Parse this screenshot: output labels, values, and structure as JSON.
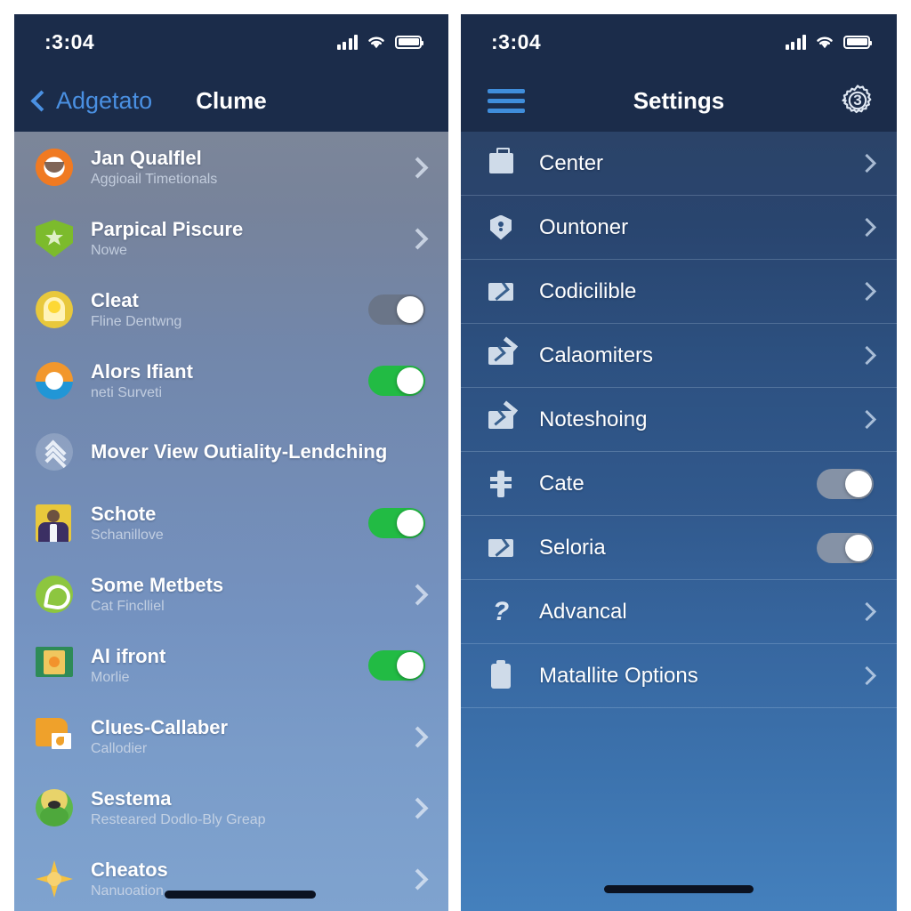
{
  "left_phone": {
    "status_bar": {
      "time": ":3:04",
      "icons": [
        "signal-icon",
        "wifi-icon",
        "battery-icon"
      ]
    },
    "navbar": {
      "back_label": "Adgetato",
      "title": "Clume"
    },
    "rows": [
      {
        "title": "Jan Qualflel",
        "subtitle": "Aggioail Timetionals",
        "icon": "avatar-orange-icon",
        "accessory": "chevron"
      },
      {
        "title": "Parpical Piscure",
        "subtitle": "Nowe",
        "icon": "shield-green-icon",
        "accessory": "chevron"
      },
      {
        "title": "Cleat",
        "subtitle": "Fline Dentwng",
        "icon": "lamp-yellow-icon",
        "accessory": "toggle",
        "toggle_on": false
      },
      {
        "title": "Alors Ifiant",
        "subtitle": "neti Surveti",
        "icon": "sun-sea-icon",
        "accessory": "toggle",
        "toggle_on": true
      },
      {
        "title": "Mover View Outiality-Lendching",
        "subtitle": "",
        "icon": "chevrons-up-icon",
        "accessory": "none"
      },
      {
        "title": "Schote",
        "subtitle": "Schanillove",
        "icon": "person-card-icon",
        "accessory": "toggle",
        "toggle_on": true
      },
      {
        "title": "Some Metbets",
        "subtitle": "Cat Finclliel",
        "icon": "phone-green-icon",
        "accessory": "chevron"
      },
      {
        "title": "Al ifront",
        "subtitle": "Morlie",
        "icon": "book-green-icon",
        "accessory": "toggle",
        "toggle_on": true
      },
      {
        "title": "Clues-Callaber",
        "subtitle": "Callodier",
        "icon": "folder-orange-icon",
        "accessory": "chevron"
      },
      {
        "title": "Sestema",
        "subtitle": "Resteared Dodlo-Bly Greap",
        "icon": "bug-green-icon",
        "accessory": "chevron"
      },
      {
        "title": "Cheatos",
        "subtitle": "Nanuoation",
        "icon": "star-gold-icon",
        "accessory": "chevron"
      }
    ]
  },
  "right_phone": {
    "status_bar": {
      "time": ":3:04",
      "icons": [
        "signal-icon",
        "wifi-icon",
        "battery-icon"
      ]
    },
    "navbar": {
      "menu_icon": "hamburger-icon",
      "title": "Settings",
      "gear_badge": "3"
    },
    "rows": [
      {
        "label": "Center",
        "icon": "briefcase-icon",
        "accessory": "chevron"
      },
      {
        "label": "Ountoner",
        "icon": "shield-lock-icon",
        "accessory": "chevron"
      },
      {
        "label": "Codicilible",
        "icon": "envelope-icon",
        "accessory": "chevron"
      },
      {
        "label": "Calaomiters",
        "icon": "envelope-check-icon",
        "accessory": "chevron"
      },
      {
        "label": "Noteshoing",
        "icon": "envelope-check-icon",
        "accessory": "chevron"
      },
      {
        "label": "Cate",
        "icon": "key-icon",
        "accessory": "toggle",
        "toggle_on": false
      },
      {
        "label": "Seloria",
        "icon": "envelope-icon",
        "accessory": "toggle",
        "toggle_on": false
      },
      {
        "label": "Advancal",
        "icon": "question-mark-icon",
        "accessory": "chevron"
      },
      {
        "label": "Matallite Options",
        "icon": "clipboard-icon",
        "accessory": "chevron"
      }
    ]
  },
  "colors": {
    "navbar": "#1b2c4a",
    "accent_blue": "#4a90e2",
    "toggle_on": "#22bb44",
    "toggle_off_left": "#6a7588",
    "toggle_off_right": "#8592a6",
    "left_bg_top": "#7c8699",
    "left_bg_bottom": "#7fa3cf",
    "right_bg_top": "#2b4368",
    "right_bg_bottom": "#4480bd"
  }
}
